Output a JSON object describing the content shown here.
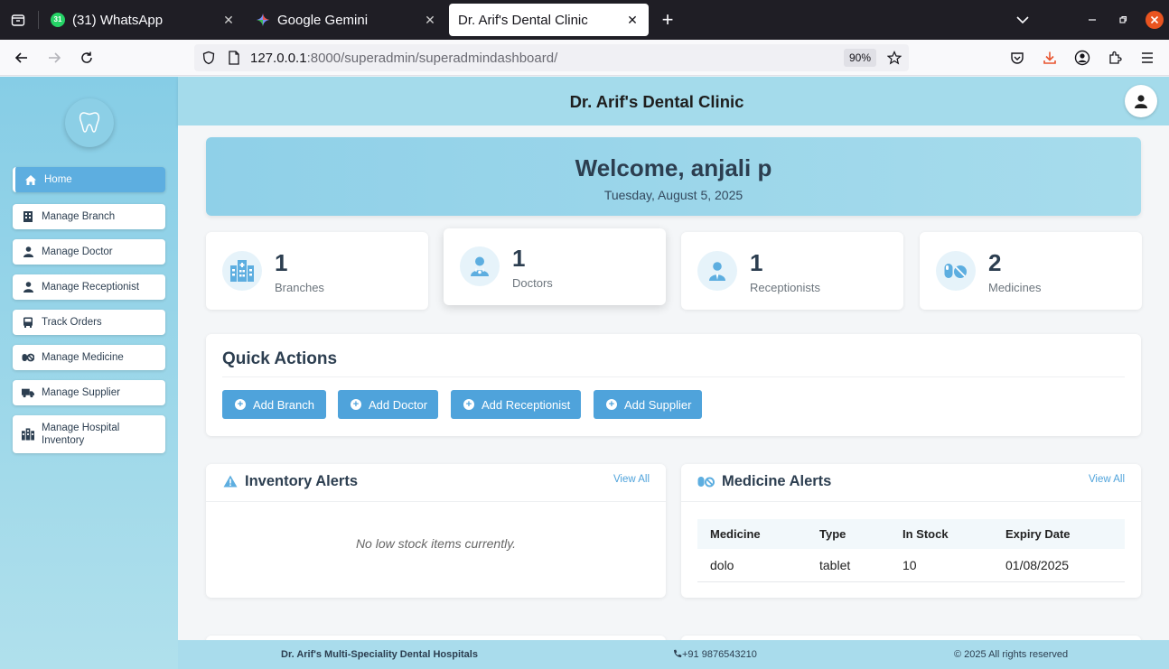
{
  "browser": {
    "tabs": [
      {
        "title": "(31) WhatsApp",
        "badge": "31",
        "active": false
      },
      {
        "title": "Google Gemini",
        "active": false
      },
      {
        "title": "Dr. Arif's Dental Clinic",
        "active": true
      }
    ],
    "url_host": "127.0.0.1",
    "url_path": ":8000/superadmin/superadmindashboard/",
    "zoom": "90%"
  },
  "sidebar": {
    "items": [
      {
        "label": "Home",
        "icon": "home-icon",
        "active": true
      },
      {
        "label": "Manage Branch",
        "icon": "building-icon"
      },
      {
        "label": "Manage Doctor",
        "icon": "doctor-icon"
      },
      {
        "label": "Manage Receptionist",
        "icon": "person-icon"
      },
      {
        "label": "Track Orders",
        "icon": "bus-icon"
      },
      {
        "label": "Manage Medicine",
        "icon": "pills-icon"
      },
      {
        "label": "Manage Supplier",
        "icon": "truck-icon"
      },
      {
        "label": "Manage Hospital Inventory",
        "icon": "inventory-icon"
      }
    ]
  },
  "header": {
    "title": "Dr. Arif's Dental Clinic"
  },
  "welcome": {
    "heading": "Welcome, anjali p",
    "date": "Tuesday, August 5, 2025"
  },
  "stats": [
    {
      "value": "1",
      "label": "Branches",
      "icon": "hospital-icon"
    },
    {
      "value": "1",
      "label": "Doctors",
      "icon": "doctor-icon"
    },
    {
      "value": "1",
      "label": "Receptionists",
      "icon": "person-icon"
    },
    {
      "value": "2",
      "label": "Medicines",
      "icon": "pills-icon"
    }
  ],
  "quick_actions": {
    "title": "Quick Actions",
    "buttons": [
      "Add Branch",
      "Add Doctor",
      "Add Receptionist",
      "Add Supplier"
    ]
  },
  "inventory_alerts": {
    "title": "Inventory Alerts",
    "view_all": "View All",
    "empty": "No low stock items currently."
  },
  "medicine_alerts": {
    "title": "Medicine Alerts",
    "view_all": "View All",
    "columns": [
      "Medicine",
      "Type",
      "In Stock",
      "Expiry Date"
    ],
    "rows": [
      [
        "dolo",
        "tablet",
        "10",
        "01/08/2025"
      ]
    ]
  },
  "footer": {
    "name": "Dr. Arif's Multi-Speciality Dental Hospitals",
    "phone": "+91 9876543210",
    "copyright": "© 2025 All rights reserved"
  },
  "colors": {
    "accent": "#4fa3db",
    "sidebar": "#86cde6",
    "header": "#a4dbeb"
  }
}
